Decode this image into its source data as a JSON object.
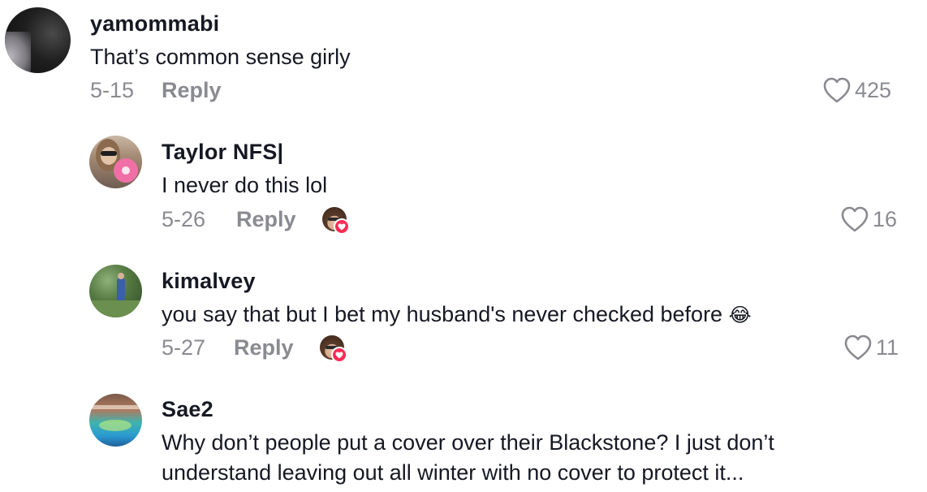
{
  "comments": [
    {
      "username": "yamommabi",
      "text": "That’s common sense girly",
      "date": "5-15",
      "reply_label": "Reply",
      "likes": "425"
    },
    {
      "username": "Taylor NFS|",
      "text": "I never do this lol",
      "date": "5-26",
      "reply_label": "Reply",
      "likes": "16",
      "creator_liked": true
    },
    {
      "username": "kimalvey",
      "text": "you say that but I bet my husband's never checked before",
      "emoji": "😂",
      "date": "5-27",
      "reply_label": "Reply",
      "likes": "11",
      "creator_liked": true
    },
    {
      "username": "Sae2",
      "text_lines": [
        "Why don’t people put a cover over their Blackstone? I just don’t",
        "understand leaving out all winter with no cover to protect it..."
      ]
    }
  ],
  "colors": {
    "text": "#161823",
    "muted": "#8a8b91",
    "creator_heart": "#fe2c55"
  },
  "icons": {
    "like": "heart-outline-icon",
    "creator_like": "creator-liked-badge"
  }
}
